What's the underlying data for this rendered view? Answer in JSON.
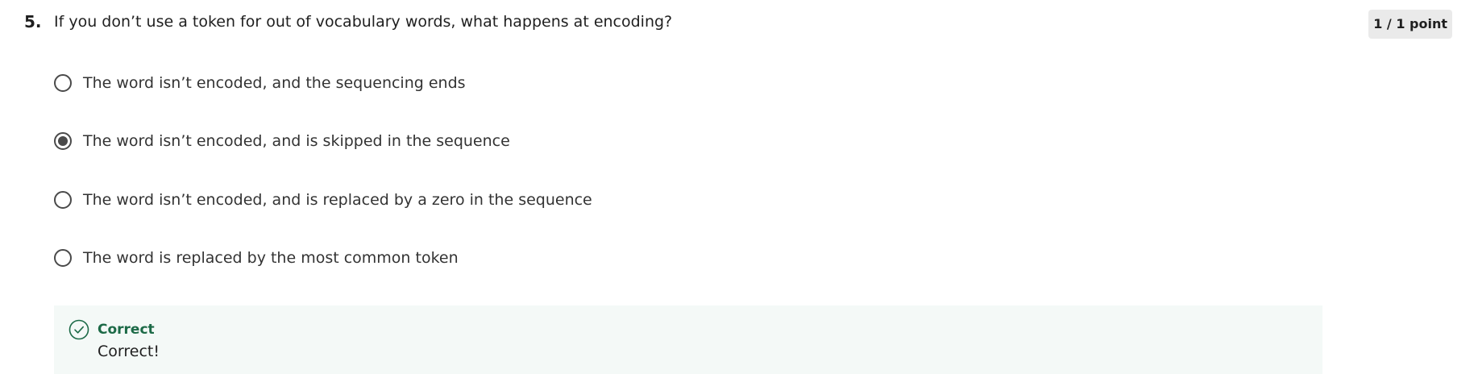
{
  "question": {
    "number": "5.",
    "text": "If you don’t use a token for out of vocabulary words, what happens at encoding?",
    "points": "1 / 1 point"
  },
  "options": [
    {
      "label": "The word isn’t encoded, and the sequencing ends",
      "selected": false
    },
    {
      "label": "The word isn’t encoded, and is skipped in the sequence",
      "selected": true
    },
    {
      "label": "The word isn’t encoded, and is replaced by a zero in the sequence",
      "selected": false
    },
    {
      "label": "The word is replaced by the most common token",
      "selected": false
    }
  ],
  "feedback": {
    "icon": "check-circle-icon",
    "title": "Correct",
    "message": "Correct!",
    "accent_color": "#1c6a47"
  }
}
